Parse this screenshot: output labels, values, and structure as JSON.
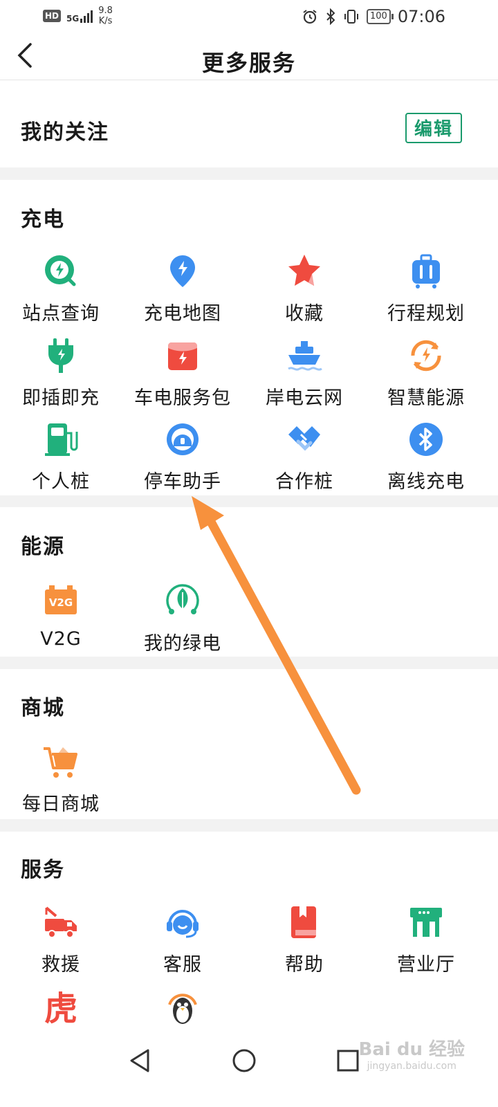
{
  "status_bar": {
    "hd": "HD",
    "network": "5G",
    "speed_value": "9.8",
    "speed_unit": "K/s",
    "battery": "100",
    "time": "07:06"
  },
  "header": {
    "title": "更多服务"
  },
  "favorites": {
    "title": "我的关注",
    "edit_label": "编辑"
  },
  "sections": {
    "charging": {
      "title": "充电",
      "items": [
        {
          "label": "站点查询",
          "icon": "station-search-icon"
        },
        {
          "label": "充电地图",
          "icon": "charging-map-icon"
        },
        {
          "label": "收藏",
          "icon": "star-icon"
        },
        {
          "label": "行程规划",
          "icon": "luggage-icon"
        },
        {
          "label": "即插即充",
          "icon": "plug-icon"
        },
        {
          "label": "车电服务包",
          "icon": "service-pack-icon"
        },
        {
          "label": "岸电云网",
          "icon": "ship-icon"
        },
        {
          "label": "智慧能源",
          "icon": "smart-energy-icon"
        },
        {
          "label": "个人桩",
          "icon": "personal-charger-icon"
        },
        {
          "label": "停车助手",
          "icon": "parking-assistant-icon"
        },
        {
          "label": "合作桩",
          "icon": "handshake-icon"
        },
        {
          "label": "离线充电",
          "icon": "bluetooth-icon"
        }
      ]
    },
    "energy": {
      "title": "能源",
      "items": [
        {
          "label": "V2G",
          "icon": "v2g-battery-icon",
          "icon_text": "V2G"
        },
        {
          "label": "我的绿电",
          "icon": "green-power-icon"
        }
      ]
    },
    "mall": {
      "title": "商城",
      "items": [
        {
          "label": "每日商城",
          "icon": "shopping-cart-icon"
        }
      ]
    },
    "services": {
      "title": "服务",
      "items": [
        {
          "label": "救援",
          "icon": "tow-truck-icon"
        },
        {
          "label": "客服",
          "icon": "headset-icon"
        },
        {
          "label": "帮助",
          "icon": "book-icon"
        },
        {
          "label": "营业厅",
          "icon": "storefront-icon"
        },
        {
          "label": "",
          "icon": "tiger-logo-icon",
          "icon_text": "虎"
        },
        {
          "label": "",
          "icon": "penguin-icon"
        }
      ]
    }
  },
  "watermark": {
    "text": "Bai du 经验",
    "sub": "jingyan.baidu.com"
  },
  "colors": {
    "accent": "#1a9a6c",
    "arrow": "#f7913d",
    "blue": "#3d8ff0",
    "red": "#ef4b3f",
    "orange": "#f7913d",
    "green": "#21b07c"
  }
}
